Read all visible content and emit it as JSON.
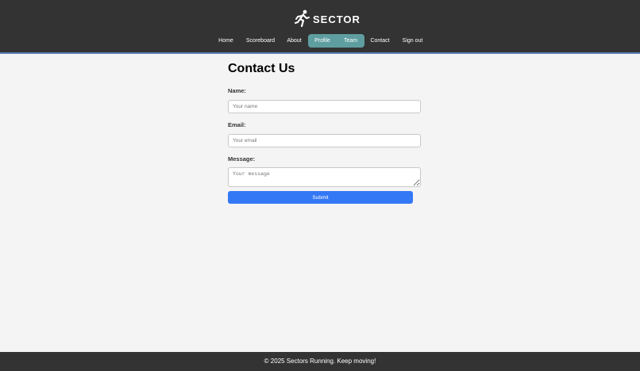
{
  "header": {
    "logo_text": "SECTOR",
    "logo_icon": "runner-icon",
    "nav": [
      {
        "label": "Home"
      },
      {
        "label": "Scoreboard"
      },
      {
        "label": "About"
      },
      {
        "label": "Profile"
      },
      {
        "label": "Team"
      },
      {
        "label": "Contact"
      },
      {
        "label": "Sign out"
      }
    ],
    "accent_color": "#5f9ea0",
    "background_color": "#333333"
  },
  "form": {
    "title": "Contact Us",
    "name_label": "Name:",
    "name_placeholder": "Your name",
    "name_value": "",
    "email_label": "Email:",
    "email_placeholder": "Your email",
    "email_value": "",
    "message_label": "Message:",
    "message_placeholder": "Your message",
    "message_value": "",
    "submit_label": "Submit",
    "submit_color": "#3478f6"
  },
  "footer": {
    "text": "© 2025 Sectors Running. Keep moving!"
  }
}
